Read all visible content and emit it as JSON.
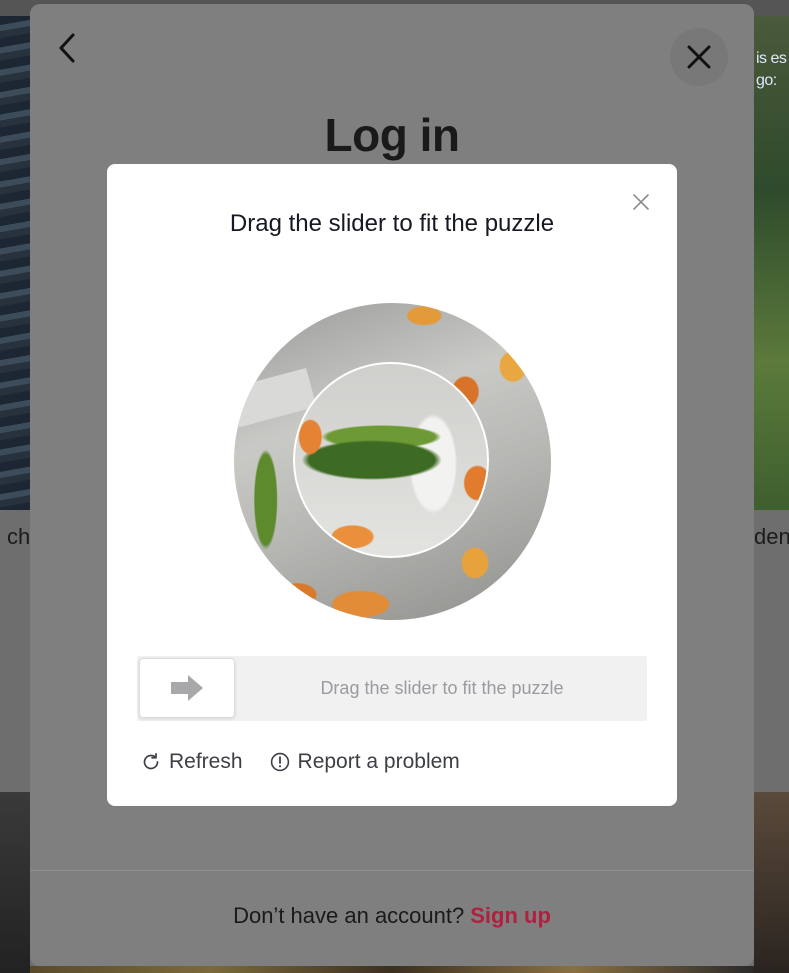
{
  "background": {
    "left_text": "ch",
    "right_text": "den",
    "right_caption": "is es\ngo:"
  },
  "login_modal": {
    "title": "Log in",
    "signup_prompt": "Don’t have an account?",
    "signup_link": "Sign up",
    "back_icon": "chevron-left-icon",
    "close_icon": "close-icon"
  },
  "captcha": {
    "title": "Drag the slider to fit the puzzle",
    "slider_hint": "Drag the slider to fit the puzzle",
    "slider_position": 0,
    "refresh_label": "Refresh",
    "report_label": "Report a problem",
    "close_icon": "close-icon",
    "handle_icon": "arrow-right-icon",
    "refresh_icon": "refresh-icon",
    "report_icon": "alert-circle-icon"
  },
  "colors": {
    "signup_link": "#b0203f",
    "dialog_bg": "#ffffff",
    "slider_track": "#f1f1f2"
  }
}
